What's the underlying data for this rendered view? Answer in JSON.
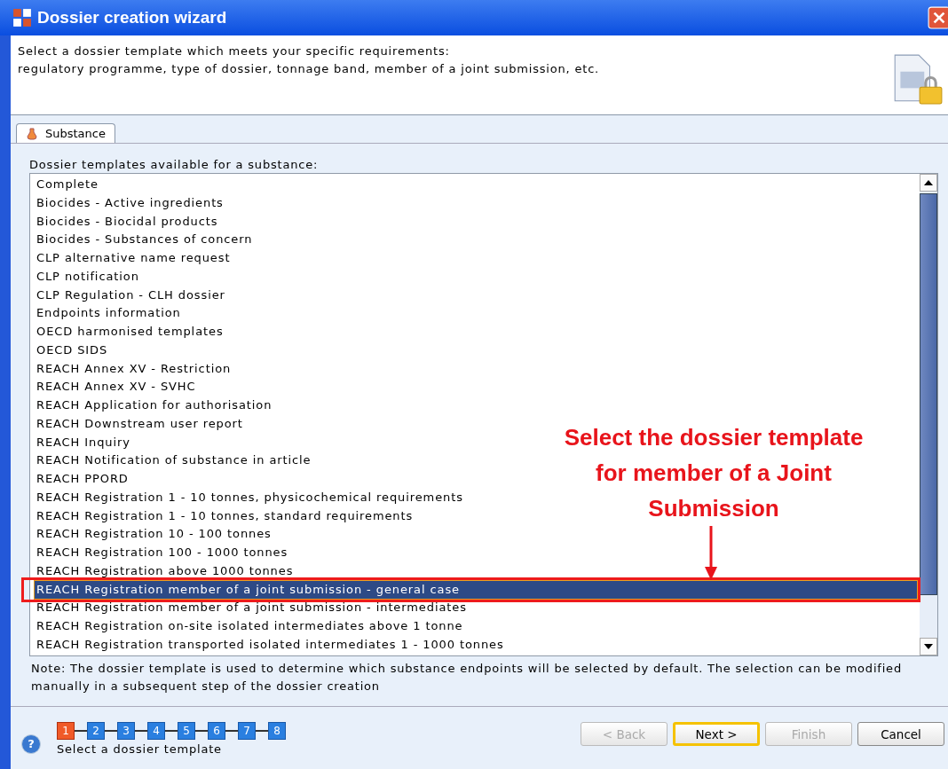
{
  "window": {
    "title": "Dossier creation wizard"
  },
  "header": {
    "lines": [
      "Select a dossier template which meets your specific requirements:",
      "regulatory programme, type of dossier, tonnage band, member of a joint submission, etc."
    ]
  },
  "tabs": [
    {
      "label": "Substance",
      "selected": true
    }
  ],
  "list": {
    "label": "Dossier templates available for a substance:",
    "rows": [
      {
        "label": "Complete",
        "selected": false
      },
      {
        "label": "Biocides - Active ingredients",
        "selected": false
      },
      {
        "label": "Biocides - Biocidal products",
        "selected": false
      },
      {
        "label": "Biocides - Substances of concern",
        "selected": false
      },
      {
        "label": "CLP alternative name request",
        "selected": false
      },
      {
        "label": "CLP notification",
        "selected": false
      },
      {
        "label": "CLP Regulation - CLH dossier",
        "selected": false
      },
      {
        "label": "Endpoints information",
        "selected": false
      },
      {
        "label": "OECD harmonised templates",
        "selected": false
      },
      {
        "label": "OECD SIDS",
        "selected": false
      },
      {
        "label": "REACH Annex XV - Restriction",
        "selected": false
      },
      {
        "label": "REACH Annex XV - SVHC",
        "selected": false
      },
      {
        "label": "REACH Application for authorisation",
        "selected": false
      },
      {
        "label": "REACH Downstream user report",
        "selected": false
      },
      {
        "label": "REACH Inquiry",
        "selected": false
      },
      {
        "label": "REACH Notification of substance in article",
        "selected": false
      },
      {
        "label": "REACH PPORD",
        "selected": false
      },
      {
        "label": "REACH Registration 1 - 10 tonnes, physicochemical requirements",
        "selected": false
      },
      {
        "label": "REACH Registration 1 - 10 tonnes, standard requirements",
        "selected": false
      },
      {
        "label": "REACH Registration 10 - 100 tonnes",
        "selected": false
      },
      {
        "label": "REACH Registration 100 - 1000 tonnes",
        "selected": false
      },
      {
        "label": "REACH Registration above 1000 tonnes",
        "selected": false
      },
      {
        "label": "REACH Registration member of a joint submission - general case",
        "selected": true
      },
      {
        "label": "REACH Registration member of a joint submission - intermediates",
        "selected": false
      },
      {
        "label": "REACH Registration on-site isolated intermediates above 1 tonne",
        "selected": false
      },
      {
        "label": "REACH Registration transported isolated intermediates 1 - 1000 tonnes",
        "selected": false
      }
    ]
  },
  "note": "Note: The dossier template is used to determine which substance endpoints will be selected by default. The selection can be modified manually in a subsequent step of the dossier creation",
  "annotation": "Select the dossier template for member of a Joint Submission",
  "steps": [
    {
      "label": "1",
      "selected": true
    },
    {
      "label": "2",
      "selected": false
    },
    {
      "label": "3",
      "selected": false
    },
    {
      "label": "4",
      "selected": false
    },
    {
      "label": "5",
      "selected": false
    },
    {
      "label": "6",
      "selected": false
    },
    {
      "label": "7",
      "selected": false
    },
    {
      "label": "8",
      "selected": false
    }
  ],
  "step_caption": "Select a dossier template",
  "help_icon": "?",
  "buttons": [
    {
      "label": "< Back",
      "disabled": true,
      "default": false
    },
    {
      "label": "Next >",
      "disabled": false,
      "default": true
    },
    {
      "label": "Finish",
      "disabled": true,
      "default": false
    },
    {
      "label": "Cancel",
      "disabled": false,
      "default": false
    }
  ]
}
